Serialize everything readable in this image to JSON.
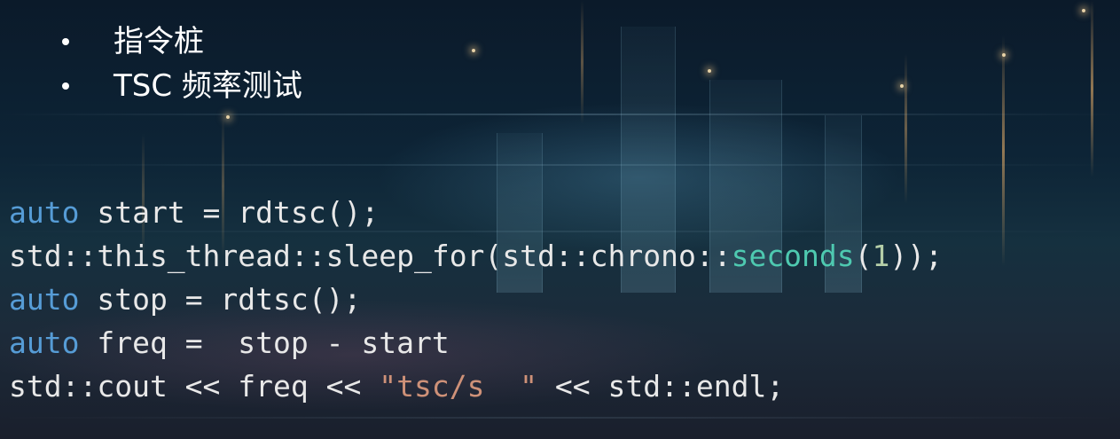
{
  "bullets": [
    {
      "text": "指令桩"
    },
    {
      "text": "TSC 频率测试"
    }
  ],
  "code": {
    "lines": [
      {
        "tokens": [
          {
            "text": "auto",
            "kind": "keyword"
          },
          {
            "text": " start = rdtsc();",
            "kind": "plain"
          }
        ]
      },
      {
        "tokens": [
          {
            "text": "std::this_thread::sleep_for(std::chrono::",
            "kind": "plain"
          },
          {
            "text": "seconds",
            "kind": "type"
          },
          {
            "text": "(",
            "kind": "plain"
          },
          {
            "text": "1",
            "kind": "number"
          },
          {
            "text": "));",
            "kind": "plain"
          }
        ]
      },
      {
        "tokens": [
          {
            "text": "auto",
            "kind": "keyword"
          },
          {
            "text": " stop = rdtsc();",
            "kind": "plain"
          }
        ]
      },
      {
        "tokens": [
          {
            "text": "auto",
            "kind": "keyword"
          },
          {
            "text": " freq =  stop - start",
            "kind": "plain"
          }
        ]
      },
      {
        "tokens": [
          {
            "text": "std::cout << freq << ",
            "kind": "plain"
          },
          {
            "text": "\"tsc/s  \"",
            "kind": "string"
          },
          {
            "text": " << std::endl;",
            "kind": "plain"
          }
        ]
      }
    ]
  },
  "colors": {
    "plain": "#e8e8e8",
    "keyword": "#569cd6",
    "type": "#4ec9b0",
    "number": "#b5cea8",
    "string": "#ce9178",
    "bullet_text": "#ffffff"
  }
}
